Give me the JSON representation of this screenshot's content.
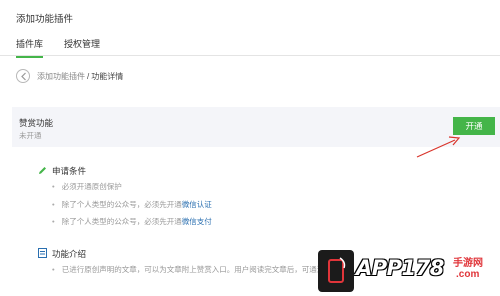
{
  "header": {
    "title": "添加功能插件",
    "tabs": [
      {
        "label": "插件库",
        "active": true
      },
      {
        "label": "授权管理",
        "active": false
      }
    ]
  },
  "breadcrumb": {
    "parent": "添加功能插件",
    "separator": "/",
    "current": "功能详情"
  },
  "feature": {
    "name": "赞赏功能",
    "status": "未开通",
    "action_label": "开通"
  },
  "requirements": {
    "title": "申请条件",
    "items": [
      {
        "text": "必须开通原创保护",
        "link": ""
      },
      {
        "text": "除了个人类型的公众号，必须先开通",
        "link": "微信认证"
      },
      {
        "text": "除了个人类型的公众号，必须先开通",
        "link": "微信支付"
      }
    ]
  },
  "intro": {
    "title": "功能介绍",
    "items": [
      {
        "text": "已进行原创声明的文章，可以为文章附上赞赏入口。用户阅读完文章后，可通过"
      }
    ]
  },
  "watermark": {
    "brand": "APP178",
    "side_line1": "手游网",
    "side_line2": ".com"
  },
  "colors": {
    "accent": "#44b549",
    "arrow": "#d9342b",
    "link": "#2a6fb0",
    "panel": "#f4f5f9"
  }
}
